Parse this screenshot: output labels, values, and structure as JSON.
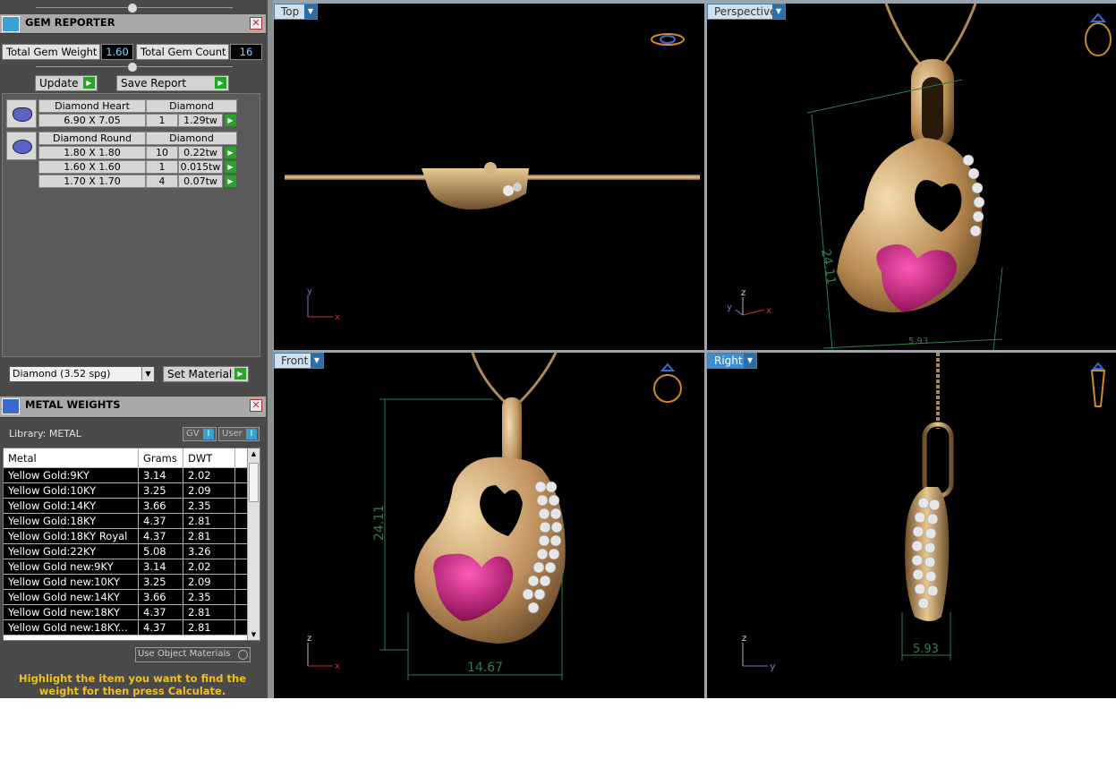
{
  "gem_reporter": {
    "title": "GEM REPORTER",
    "total_weight_label": "Total Gem Weight",
    "total_weight_value": "1.60",
    "total_count_label": "Total Gem Count",
    "total_count_value": "16",
    "update_label": "Update",
    "save_report_label": "Save Report",
    "groups": [
      {
        "shape": "Diamond Heart",
        "material": "Diamond",
        "rows": [
          {
            "size": "6.90 X 7.05",
            "qty": "1",
            "wt": "1.29tw"
          }
        ]
      },
      {
        "shape": "Diamond Round",
        "material": "Diamond",
        "rows": [
          {
            "size": "1.80 X 1.80",
            "qty": "10",
            "wt": "0.22tw"
          },
          {
            "size": "1.60 X 1.60",
            "qty": "1",
            "wt": "0.015tw"
          },
          {
            "size": "1.70 X 1.70",
            "qty": "4",
            "wt": "0.07tw"
          }
        ]
      }
    ],
    "material_select": "Diamond     (3.52 spg)",
    "set_material_label": "Set Material"
  },
  "metal_weights": {
    "title": "METAL WEIGHTS",
    "library_label": "Library: METAL",
    "gv_label": "GV",
    "user_label": "User",
    "columns": [
      "Metal",
      "Grams",
      "DWT"
    ],
    "rows": [
      [
        "Yellow Gold:9KY",
        "3.14",
        "2.02"
      ],
      [
        "Yellow Gold:10KY",
        "3.25",
        "2.09"
      ],
      [
        "Yellow Gold:14KY",
        "3.66",
        "2.35"
      ],
      [
        "Yellow Gold:18KY",
        "4.37",
        "2.81"
      ],
      [
        "Yellow Gold:18KY Royal",
        "4.37",
        "2.81"
      ],
      [
        "Yellow Gold:22KY",
        "5.08",
        "3.26"
      ],
      [
        "Yellow Gold new:9KY",
        "3.14",
        "2.02"
      ],
      [
        "Yellow Gold new:10KY",
        "3.25",
        "2.09"
      ],
      [
        "Yellow Gold new:14KY",
        "3.66",
        "2.35"
      ],
      [
        "Yellow Gold new:18KY",
        "4.37",
        "2.81"
      ],
      [
        "Yellow Gold new:18KY...",
        "4.37",
        "2.81"
      ]
    ],
    "use_object_materials_label": "Use Object Materials",
    "hint": "Highlight the item you want to find the weight for then press Calculate."
  },
  "viewports": {
    "top": {
      "label": "Top"
    },
    "perspective": {
      "label": "Perspective"
    },
    "front": {
      "label": "Front",
      "dim_height": "24.11",
      "dim_width": "14.67"
    },
    "right": {
      "label": "Right",
      "dim_depth": "5.93"
    },
    "perspective_dims": {
      "height": "24.11",
      "depth": "5.93"
    }
  },
  "colors": {
    "gold": "#c9a46a",
    "gem": "#c2187a",
    "accent": "#3b8fd0",
    "dim_line": "#2e7d4f"
  }
}
